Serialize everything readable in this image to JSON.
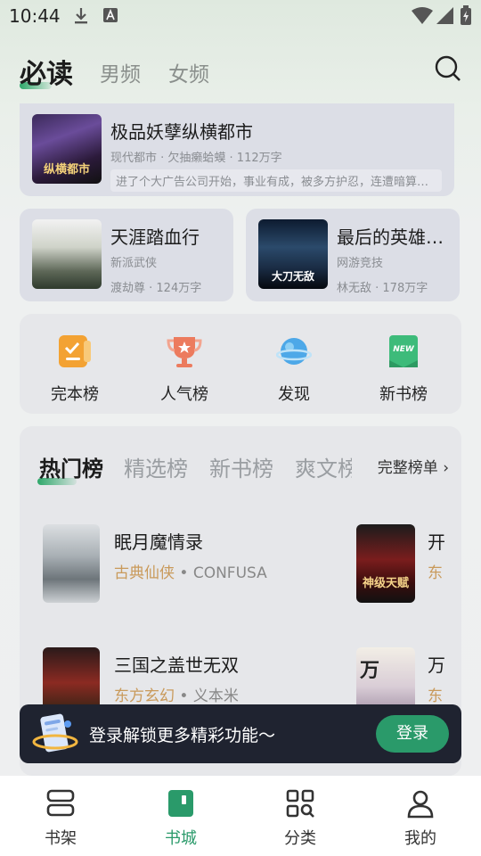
{
  "status_bar": {
    "time": "10:44"
  },
  "top_tabs": [
    {
      "label": "必读",
      "active": true
    },
    {
      "label": "男频",
      "active": false
    },
    {
      "label": "女频",
      "active": false
    }
  ],
  "featured": {
    "cover_text": "纵横都市",
    "title": "极品妖孽纵横都市",
    "meta": "现代都市 · 欠抽癞蛤蟆 · 112万字",
    "desc": "进了个大广告公司开始，事业有成，被多方护忍，连遭暗算，…"
  },
  "cards": [
    {
      "title": "天涯踏血行",
      "genre": "新派武侠",
      "meta": "渡劫尊 · 124万字"
    },
    {
      "title": "最后的英雄之…",
      "genre": "网游竞技",
      "meta": "林无敌 · 178万字",
      "cover_text": "大刀无敌"
    }
  ],
  "rank_items": [
    {
      "label": "完本榜",
      "icon": "checklist-icon"
    },
    {
      "label": "人气榜",
      "icon": "trophy-icon"
    },
    {
      "label": "发现",
      "icon": "planet-icon"
    },
    {
      "label": "新书榜",
      "icon": "new-badge-icon",
      "badge": "NEW"
    }
  ],
  "hot_tabs": [
    {
      "label": "热门榜",
      "active": true
    },
    {
      "label": "精选榜",
      "active": false
    },
    {
      "label": "新书榜",
      "active": false
    },
    {
      "label": "爽文榜",
      "active": false
    }
  ],
  "full_list_label": "完整榜单",
  "hot_list": [
    {
      "title": "眠月魔情录",
      "genre": "古典仙侠",
      "author": "CONFUSA"
    },
    {
      "title": "开",
      "genre": "东",
      "author": "",
      "cover_text": "神级天赋"
    },
    {
      "title": "三国之盖世无双",
      "genre": "东方玄幻",
      "author": "义本米"
    },
    {
      "title": "万",
      "genre": "东",
      "author": "",
      "cover_text": "万"
    }
  ],
  "login_banner": {
    "text": "登录解锁更多精彩功能～",
    "button": "登录"
  },
  "bottom_nav": [
    {
      "label": "书架",
      "icon": "bookshelf-icon",
      "active": false
    },
    {
      "label": "书城",
      "icon": "bookstore-icon",
      "active": true
    },
    {
      "label": "分类",
      "icon": "category-icon",
      "active": false
    },
    {
      "label": "我的",
      "icon": "profile-icon",
      "active": false
    }
  ],
  "colors": {
    "accent": "#2a9a6a",
    "genre": "#c99a5b",
    "banner_bg": "#1f2330"
  }
}
